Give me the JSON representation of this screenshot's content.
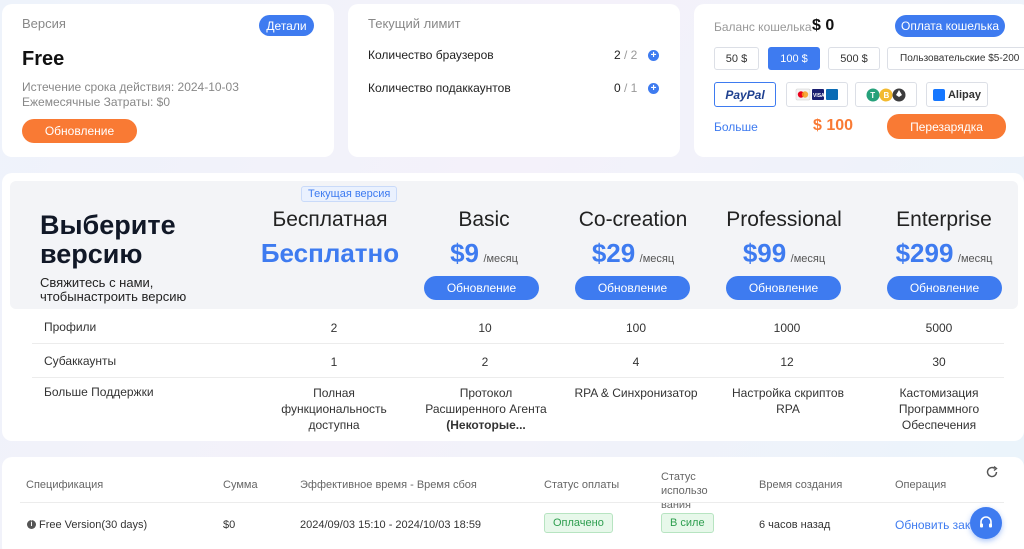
{
  "version_card": {
    "label": "Версия",
    "details_button": "Детали",
    "plan": "Free",
    "expiry": "Истечение срока действия: 2024-10-03",
    "monthly": "Ежемесячные Затраты: $0",
    "upgrade_button": "Обновление"
  },
  "limit_card": {
    "label": "Текущий лимит",
    "rows": [
      {
        "label": "Количество браузеров",
        "used": "2",
        "total": "/ 2"
      },
      {
        "label": "Количество подаккаунтов",
        "used": "0",
        "total": "/ 1"
      }
    ]
  },
  "wallet_card": {
    "label": "Баланс кошелька",
    "balance": "$ 0",
    "pay_button": "Оплата кошелька",
    "amounts": [
      "50 $",
      "100 $",
      "500 $",
      "Пользовательские $5-200"
    ],
    "selected_amount": "100 $",
    "payment_methods": [
      "PayPal",
      "Cards",
      "Crypto",
      "Alipay"
    ],
    "more_link": "Больше",
    "total": "$ 100",
    "recharge_button": "Перезарядка"
  },
  "plans": {
    "title": "Выберите версию",
    "subtitle": "Свяжитесь с нами, чтобынастроить версию",
    "current_tag": "Текущая версия",
    "columns": [
      {
        "name": "Бесплатная",
        "price": "Бесплатно",
        "per": ""
      },
      {
        "name": "Basic",
        "price": "$9",
        "per": "/месяц",
        "button": "Обновление"
      },
      {
        "name": "Co-creation",
        "price": "$29",
        "per": "/месяц",
        "button": "Обновление"
      },
      {
        "name": "Professional",
        "price": "$99",
        "per": "/месяц",
        "button": "Обновление"
      },
      {
        "name": "Enterprise",
        "price": "$299",
        "per": "/месяц",
        "button": "Обновление"
      }
    ],
    "rows": [
      {
        "label": "Профили",
        "values": [
          "2",
          "10",
          "100",
          "1000",
          "5000"
        ]
      },
      {
        "label": "Субаккаунты",
        "values": [
          "1",
          "2",
          "4",
          "12",
          "30"
        ]
      },
      {
        "label": "Больше Поддержки",
        "values": [
          "Полная функциональность доступна",
          "Протокол Расширенного Агента",
          "RPA & Синхронизатор",
          "Настройка скриптов RPA",
          "Кастомизация Программного Обеспечения"
        ]
      }
    ],
    "basic_support_bold": "(Некоторые..."
  },
  "orders": {
    "headers": [
      "Спецификация",
      "Сумма",
      "Эффективное время - Время сбоя",
      "Статус оплаты",
      "Статус использования",
      "Время создания",
      "Операция"
    ],
    "header_usage_line1": "Статус использо",
    "header_usage_line2": "вания",
    "row": {
      "spec": "Free Version(30 days)",
      "amount": "$0",
      "period": "2024/09/03 15:10 - 2024/10/03 18:59",
      "payment_status": "Оплачено",
      "usage_status": "В силе",
      "created": "6 часов назад",
      "operation": "Обновить зака"
    }
  },
  "colors": {
    "accent": "#3e7bf0",
    "orange": "#f97a34",
    "green": "#2e9e4f"
  }
}
